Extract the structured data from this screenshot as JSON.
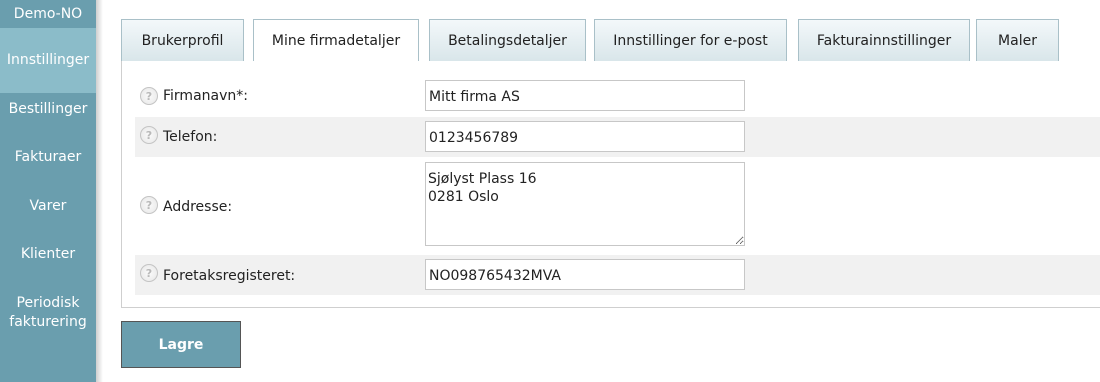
{
  "sidebar": {
    "brand": "Demo-NO",
    "items": [
      {
        "label": "Innstillinger"
      },
      {
        "label": "Bestillinger"
      },
      {
        "label": "Fakturaer"
      },
      {
        "label": "Varer"
      },
      {
        "label": "Klienter"
      },
      {
        "label": "Periodisk fakturering"
      }
    ],
    "active_index": 0
  },
  "tabs": [
    {
      "label": "Brukerprofil"
    },
    {
      "label": "Mine firmadetaljer"
    },
    {
      "label": "Betalingsdetaljer"
    },
    {
      "label": "Innstillinger for e-post"
    },
    {
      "label": "Fakturainnstillinger"
    },
    {
      "label": "Maler"
    }
  ],
  "active_tab": "Mine firmadetaljer",
  "form": {
    "help_glyph": "?",
    "fields": [
      {
        "label": "Firmanavn*:",
        "value": "Mitt firma AS"
      },
      {
        "label": "Telefon:",
        "value": "0123456789"
      },
      {
        "label": "Addresse:",
        "value": "Sjølyst Plass 16\n0281 Oslo"
      },
      {
        "label": "Foretaksregisteret:",
        "value": "NO098765432MVA"
      }
    ]
  },
  "save_label": "Lagre",
  "colors": {
    "sidebar": "#6a9eae",
    "sidebar_active": "#8bbcc9",
    "tab_border": "#a9c0c8"
  }
}
